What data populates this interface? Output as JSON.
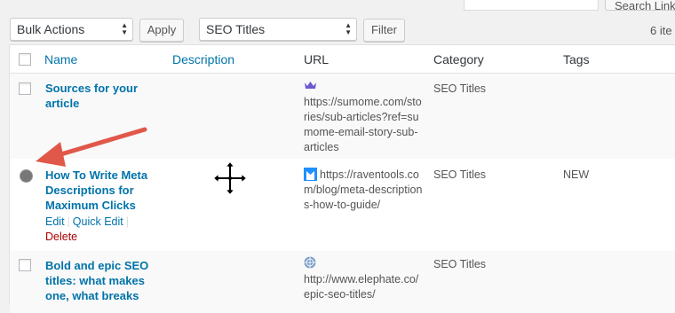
{
  "top_bar": {
    "search_value": "",
    "search_button_label": "Search Links"
  },
  "toolbar": {
    "bulk_actions_label": "Bulk Actions",
    "apply_label": "Apply",
    "category_filter_label": "SEO Titles",
    "filter_label": "Filter",
    "items_count": "6 ite"
  },
  "table": {
    "columns": {
      "name": "Name",
      "description": "Description",
      "url": "URL",
      "category": "Category",
      "tags": "Tags"
    },
    "rows": [
      {
        "name": "Sources for your article",
        "url": "https://sumome.com/stories/sub-articles?ref=sumome-email-story-sub-articles",
        "category": "SEO Titles",
        "tags": "",
        "favicon": "crown-icon"
      },
      {
        "name": "How To Write Meta Descriptions for Maximum Clicks",
        "url": "https://raventools.com/blog/meta-descriptions-how-to-guide/",
        "category": "SEO Titles",
        "tags": "NEW",
        "favicon": "bookmark-icon",
        "actions": {
          "edit": "Edit",
          "quick_edit": "Quick Edit",
          "delete": "Delete"
        }
      },
      {
        "name": "Bold and epic SEO titles: what makes one, what breaks",
        "url": "http://www.elephate.co/epic-seo-titles/",
        "category": "SEO Titles",
        "tags": "",
        "favicon": "globe-icon"
      }
    ]
  },
  "colors": {
    "link": "#0073aa",
    "delete": "#a00000",
    "arrow": "#e0584a"
  }
}
